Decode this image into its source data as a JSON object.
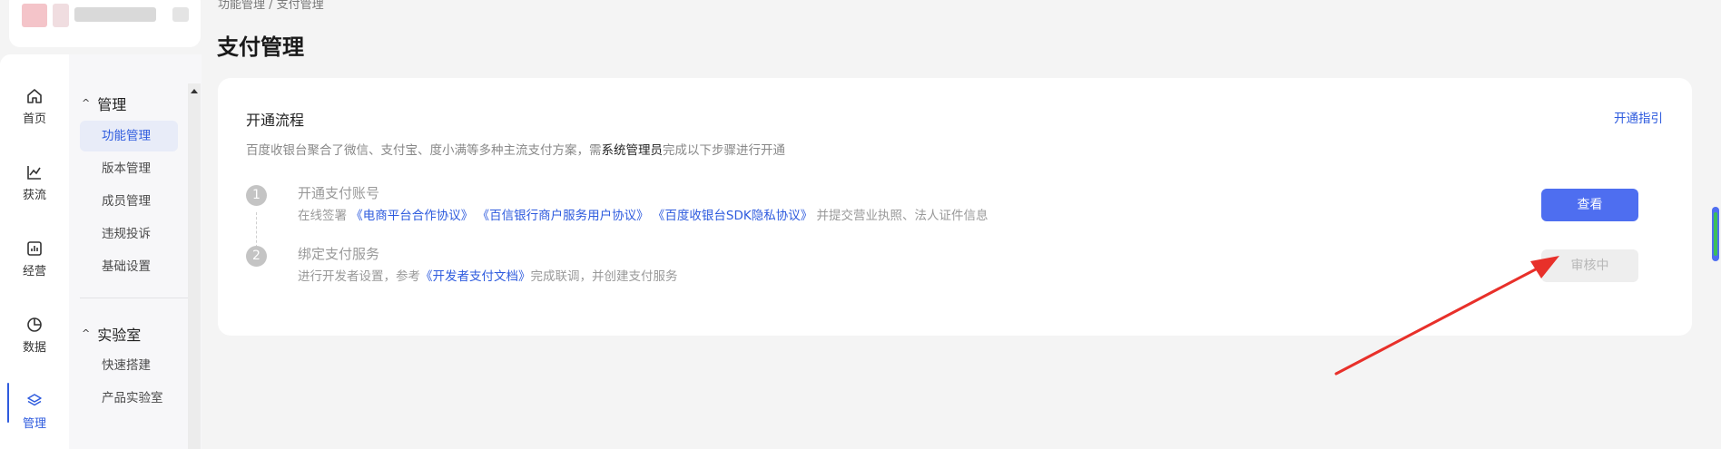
{
  "breadcrumb": "功能管理 / 支付管理",
  "page_title": "支付管理",
  "rail": [
    {
      "label": "首页",
      "icon": "home-icon"
    },
    {
      "label": "获流",
      "icon": "trend-chart-icon"
    },
    {
      "label": "经营",
      "icon": "bar-chart-icon"
    },
    {
      "label": "数据",
      "icon": "pie-chart-icon"
    },
    {
      "label": "管理",
      "icon": "layers-icon"
    }
  ],
  "submenu": {
    "group1": {
      "title": "管理",
      "items": [
        "功能管理",
        "版本管理",
        "成员管理",
        "违规投诉",
        "基础设置"
      ]
    },
    "group2": {
      "title": "实验室",
      "items": [
        "快速搭建",
        "产品实验室"
      ]
    }
  },
  "card": {
    "title": "开通流程",
    "guide_link": "开通指引",
    "desc_before": "百度收银台聚合了微信、支付宝、度小满等多种主流支付方案，需",
    "desc_strong": "系统管理员",
    "desc_after": "完成以下步骤进行开通",
    "steps": [
      {
        "num": "1",
        "title": "开通支付账号",
        "desc_prefix": "在线签署",
        "links": [
          "《电商平台合作协议》",
          "《百信银行商户服务用户协议》",
          "《百度收银台SDK隐私协议》"
        ],
        "desc_suffix": "并提交营业执照、法人证件信息",
        "button": "查看"
      },
      {
        "num": "2",
        "title": "绑定支付服务",
        "desc_prefix": "进行开发者设置，参考",
        "link": "《开发者支付文档》",
        "desc_suffix": "完成联调，并创建支付服务",
        "button": "审核中"
      }
    ]
  },
  "colors": {
    "accent": "#2e5bde",
    "primary_button": "#4e6ef0",
    "annotation_arrow": "#e8302a"
  }
}
